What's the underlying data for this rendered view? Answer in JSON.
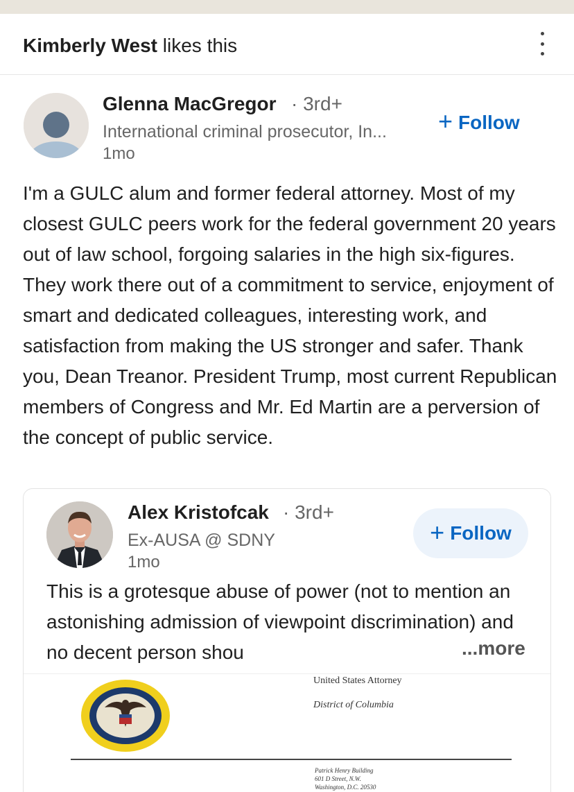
{
  "social_context": {
    "actor": "Kimberly West",
    "action": "likes this"
  },
  "post": {
    "author": {
      "name": "Glenna MacGregor",
      "degree": "· 3rd+",
      "headline": "International criminal prosecutor, In...",
      "time": "1mo"
    },
    "follow_label": "Follow",
    "text": "I'm a GULC alum and former federal attorney. Most of my closest GULC peers work for the federal government 20 years out of law school, forgoing salaries in the high six-figures. They work there out of a commitment to service, enjoyment of smart and dedicated colleagues, interesting work, and satisfaction from making the US stronger and safer. Thank you, Dean Treanor. President Trump, most current Republican members of Congress and Mr. Ed Martin are a perversion of the concept of public service."
  },
  "repost": {
    "author": {
      "name": "Alex Kristofcak",
      "degree": "· 3rd+",
      "headline": "Ex-AUSA @ SDNY",
      "time": "1mo"
    },
    "follow_label": "Follow",
    "text": "This is a grotesque abuse of power (not to mention an astonishing admission of viewpoint discrimination) and no decent person shou",
    "more_label": "...more",
    "document": {
      "title": "United States Attorney",
      "district": "District of Columbia",
      "address": [
        "Patrick Henry Building",
        "601 D Street, N.W.",
        "Washington, D.C. 20530"
      ]
    }
  },
  "icons": {
    "menu": "more-vertical-icon",
    "follow": "plus-icon",
    "avatar_placeholder": "person-icon",
    "seal": "doj-seal-icon"
  },
  "colors": {
    "link_blue": "#0a66c2",
    "secondary_text": "#666666",
    "follow_pill_bg": "#ecf3fb"
  }
}
